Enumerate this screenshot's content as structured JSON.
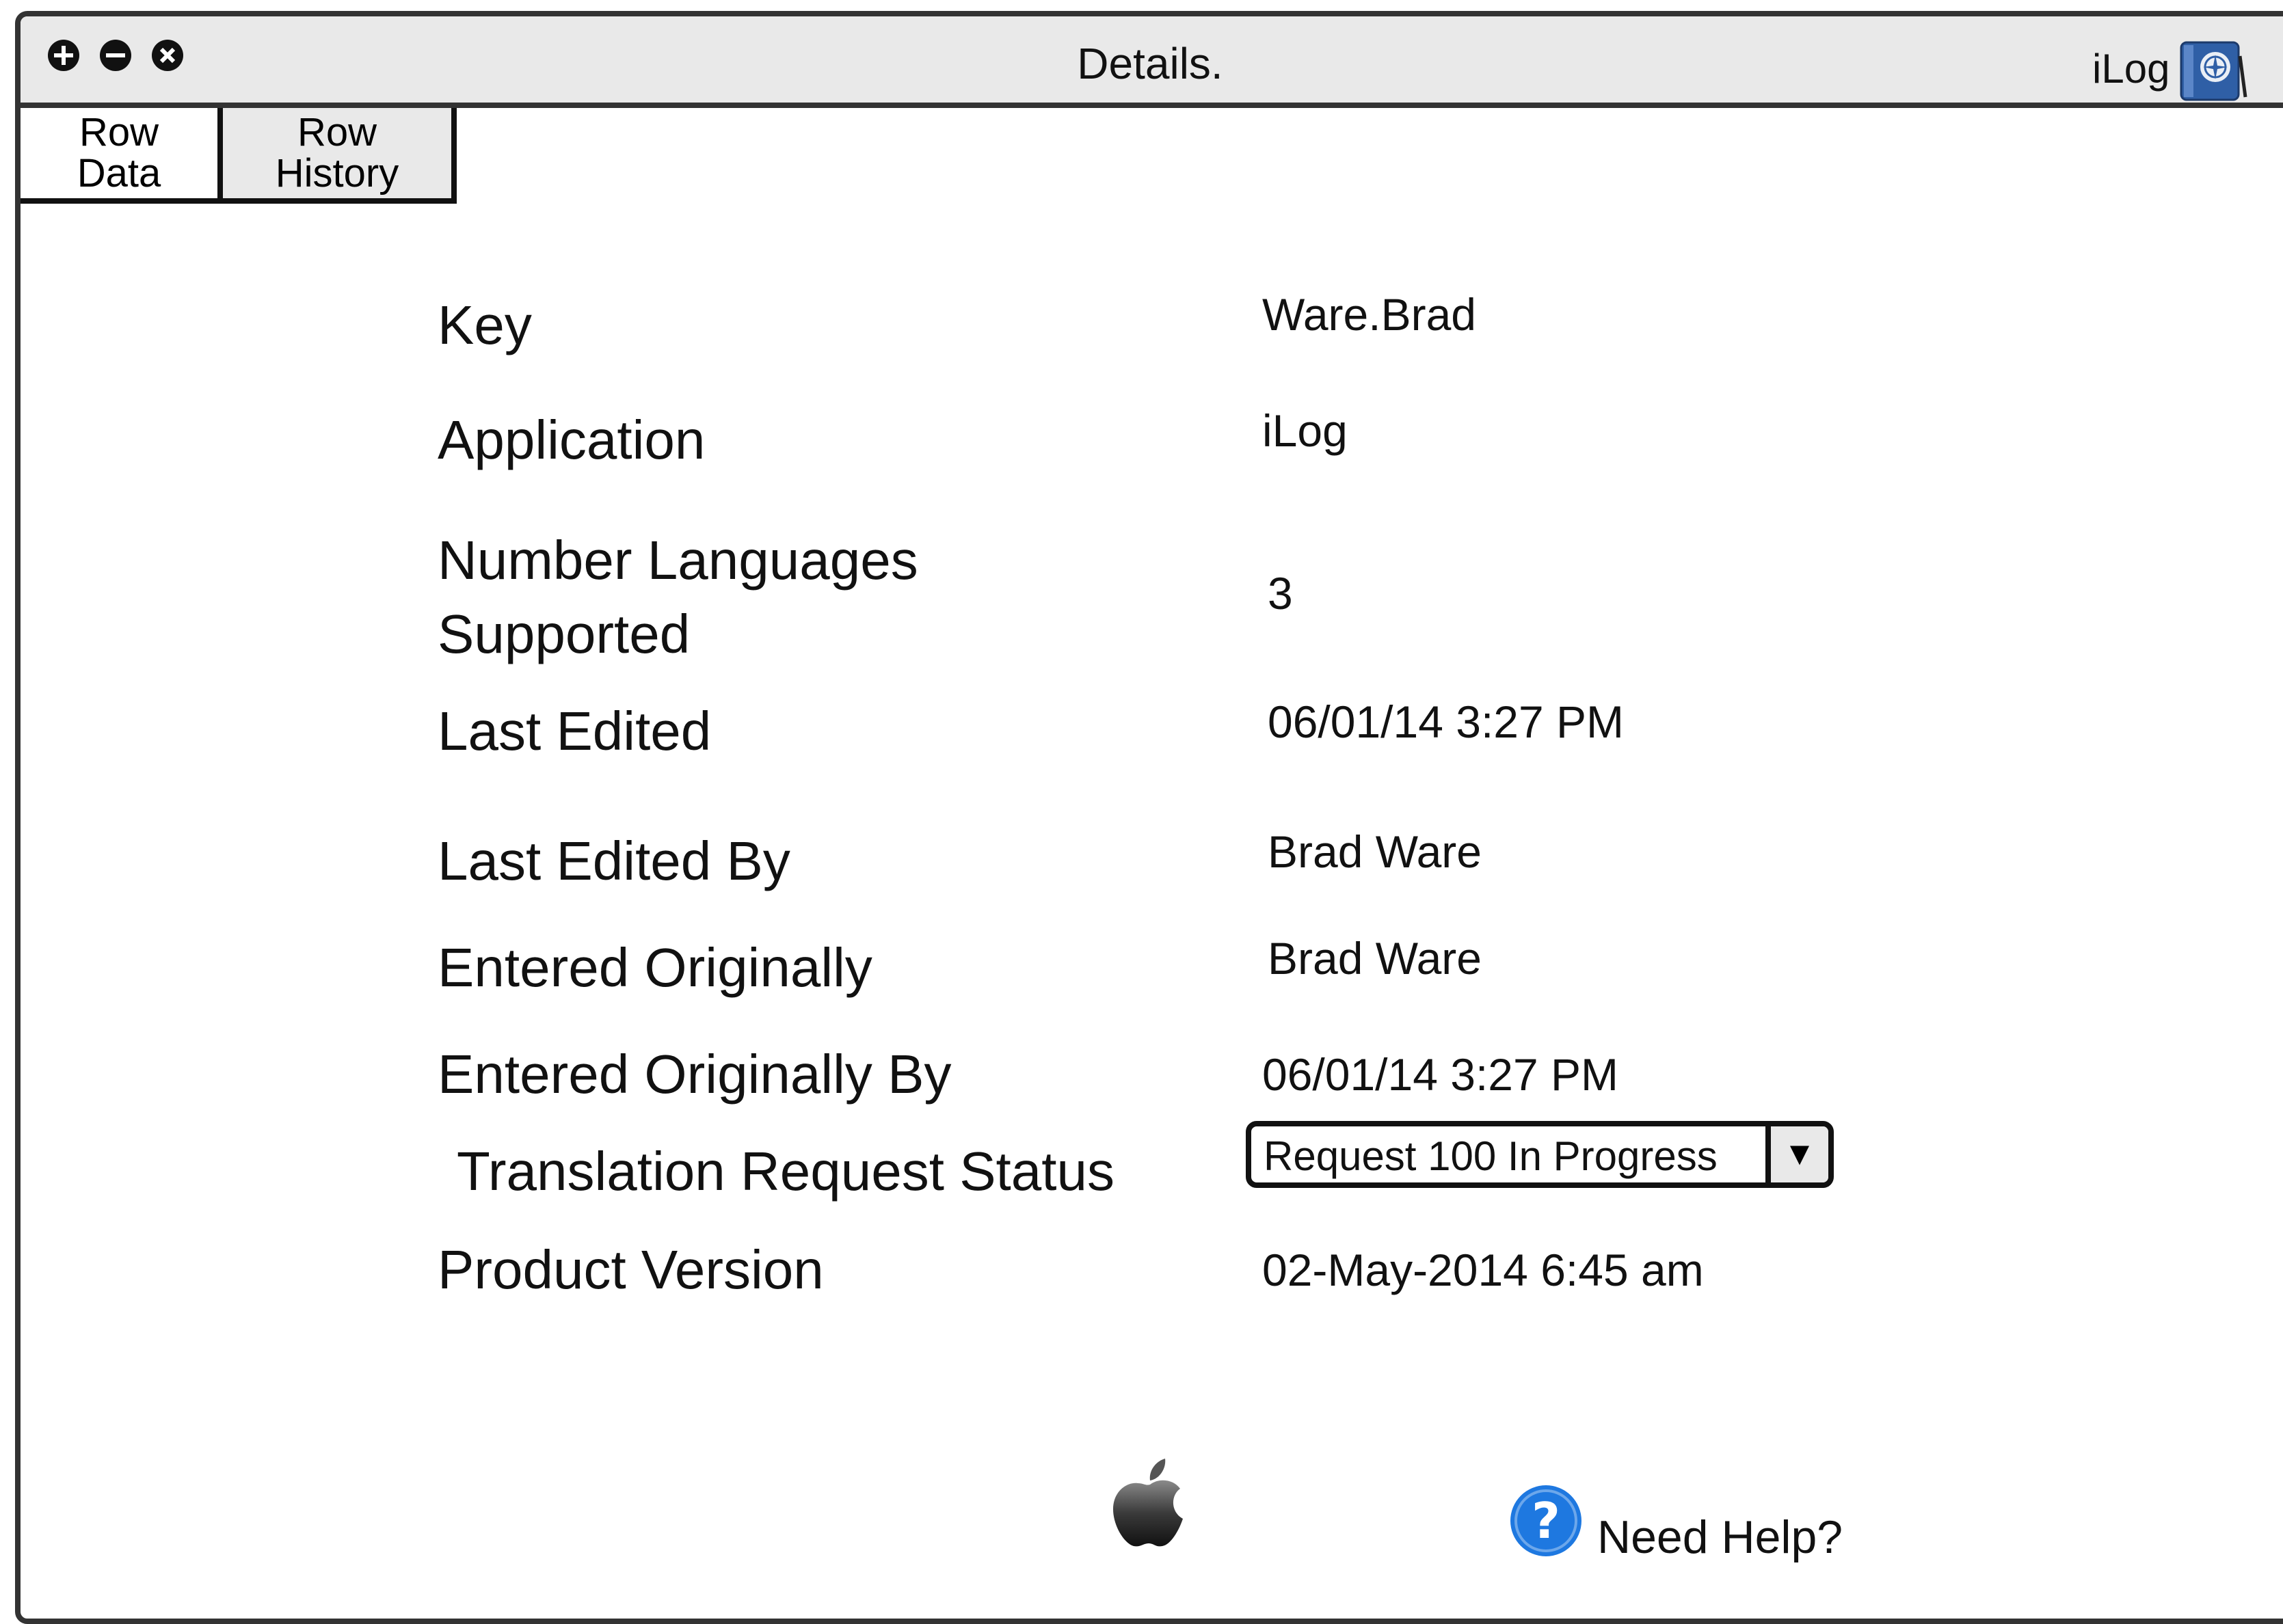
{
  "window": {
    "title": "Details.",
    "brand": "iLog",
    "controls": [
      "add-icon",
      "minus-icon",
      "close-icon"
    ]
  },
  "tabs": [
    {
      "label": "Row\nData",
      "selected": true
    },
    {
      "label": "Row\nHistory",
      "selected": false
    }
  ],
  "fields": {
    "key": {
      "label": "Key",
      "value": "Ware.Brad"
    },
    "application": {
      "label": "Application",
      "value": "iLog"
    },
    "languages": {
      "label": "Number Languages\nSupported",
      "value": "3"
    },
    "last_edited": {
      "label": "Last Edited",
      "value": "06/01/14 3:27 PM"
    },
    "last_edited_by": {
      "label": "Last Edited By",
      "value": "Brad Ware"
    },
    "entered_originally": {
      "label": "Entered Originally",
      "value": "Brad Ware"
    },
    "entered_originally_by": {
      "label": "Entered Originally By",
      "value": "06/01/14 3:27 PM"
    },
    "translation_status": {
      "label": "Translation Request Status",
      "value": "Request 100 In Progress"
    },
    "product_version": {
      "label": "Product Version",
      "value": "02-May-2014 6:45 am"
    }
  },
  "footer": {
    "icons": [
      "apple-icon",
      "help-icon"
    ],
    "help_label": "Need Help?"
  },
  "colors": {
    "titlebar": "#e9e9e9",
    "border": "#333333",
    "help_blue": "#1e78e0"
  }
}
